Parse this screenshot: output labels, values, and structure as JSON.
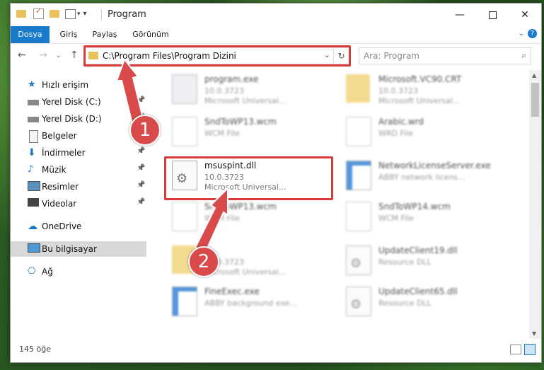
{
  "window": {
    "title": "Program"
  },
  "ribbon": {
    "tabs": [
      "Dosya",
      "Giriş",
      "Paylaş",
      "Görünüm"
    ]
  },
  "address": {
    "path": "C:\\Program Files\\Program Dizini",
    "search_placeholder": "Ara: Program"
  },
  "sidebar": {
    "items": [
      {
        "label": "Hızlı erişim",
        "icon": "star-icon"
      },
      {
        "label": "Yerel Disk (C:)",
        "icon": "drive-icon",
        "pinned": true
      },
      {
        "label": "Yerel Disk (D:)",
        "icon": "drive-icon",
        "pinned": true
      },
      {
        "label": "Belgeler",
        "icon": "documents-icon",
        "pinned": true
      },
      {
        "label": "İndirmeler",
        "icon": "download-icon",
        "pinned": true
      },
      {
        "label": "Müzik",
        "icon": "music-icon",
        "pinned": true
      },
      {
        "label": "Resimler",
        "icon": "pictures-icon",
        "pinned": true
      },
      {
        "label": "Videolar",
        "icon": "videos-icon",
        "pinned": true
      },
      {
        "label": "OneDrive",
        "icon": "cloud-icon"
      },
      {
        "label": "Bu bilgisayar",
        "icon": "computer-icon",
        "selected": true
      },
      {
        "label": "Ağ",
        "icon": "network-icon"
      }
    ]
  },
  "files": [
    {
      "name": "program.exe",
      "line2": "10.0.3723",
      "line3": "Microsoft Universal...",
      "type": "exe"
    },
    {
      "name": "Microsoft.VC90.CRT",
      "line2": "10.0.3723",
      "line3": "Microsoft Universal...",
      "type": "folder"
    },
    {
      "name": "SndToWP13.wcm",
      "line2": "WCM File",
      "line3": "",
      "type": "doc"
    },
    {
      "name": "Arabic.wrd",
      "line2": "WRD File",
      "line3": "",
      "type": "doc"
    },
    {
      "name": "msuspint.dll",
      "line2": "10.0.3723",
      "line3": "Microsoft Universal...",
      "type": "dll",
      "highlight": true
    },
    {
      "name": "NetworkLicenseServer.exe",
      "line2": "ABBY network licens...",
      "line3": "",
      "type": "app"
    },
    {
      "name": "SndToWP13.wcm",
      "line2": "WCM File",
      "line3": "",
      "type": "doc"
    },
    {
      "name": "SndToWP14.wcm",
      "line2": "WCM File",
      "line3": "",
      "type": "doc"
    },
    {
      "name": "",
      "line2": "10.0.3723",
      "line3": "Microsoft Universal...",
      "type": "folder"
    },
    {
      "name": "UpdateClient19.dll",
      "line2": "Resource DLL",
      "line3": "",
      "type": "dll"
    },
    {
      "name": "FineExec.exe",
      "line2": "ABBY background exe...",
      "line3": "",
      "type": "app"
    },
    {
      "name": "UpdateClient65.dll",
      "line2": "Resource DLL",
      "line3": "",
      "type": "dll"
    }
  ],
  "status": {
    "count": "145 öğe"
  },
  "callouts": [
    "1",
    "2"
  ],
  "colors": {
    "accent": "#1979ca",
    "highlight": "#d93a3a",
    "callout": "#d94b4b"
  }
}
